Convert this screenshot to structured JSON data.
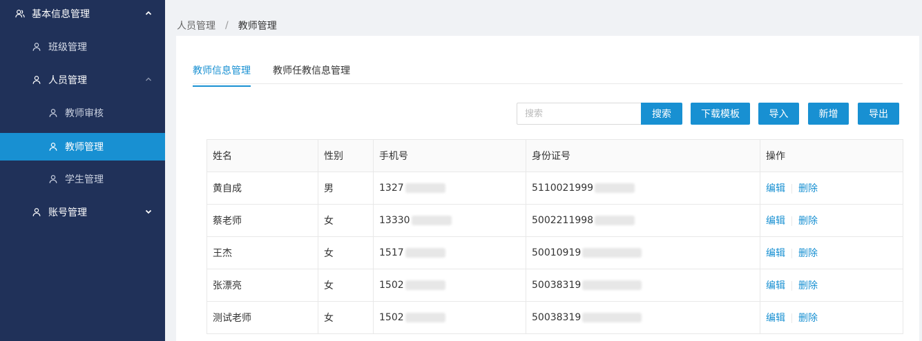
{
  "sidebar": {
    "items": [
      {
        "label": "基本信息管理",
        "icon": "user-group-icon",
        "expanded": true
      },
      {
        "label": "班级管理",
        "icon": "user-icon"
      },
      {
        "label": "人员管理",
        "icon": "user-icon",
        "expanded": true
      },
      {
        "label": "教师审核",
        "icon": "user-icon"
      },
      {
        "label": "教师管理",
        "icon": "user-icon",
        "active": true
      },
      {
        "label": "学生管理",
        "icon": "user-icon"
      },
      {
        "label": "账号管理",
        "icon": "user-icon",
        "expanded": false
      }
    ]
  },
  "breadcrumb": {
    "parent": "人员管理",
    "separator": "/",
    "current": "教师管理"
  },
  "tabs": [
    {
      "label": "教师信息管理",
      "active": true
    },
    {
      "label": "教师任教信息管理"
    }
  ],
  "toolbar": {
    "search_placeholder": "搜索",
    "search_label": "搜索",
    "download_template_label": "下载模板",
    "import_label": "导入",
    "add_label": "新增",
    "export_label": "导出"
  },
  "table": {
    "columns": [
      "姓名",
      "性别",
      "手机号",
      "身份证号",
      "操作"
    ],
    "rows": [
      {
        "name": "黄自成",
        "gender": "男",
        "phone": "1327",
        "id_card": "5110021999"
      },
      {
        "name": "蔡老师",
        "gender": "女",
        "phone": "13330",
        "id_card": "5002211998"
      },
      {
        "name": "王杰",
        "gender": "女",
        "phone": "1517",
        "id_card": "50010919"
      },
      {
        "name": "张漂亮",
        "gender": "女",
        "phone": "1502",
        "id_card": "50038319"
      },
      {
        "name": "测试老师",
        "gender": "女",
        "phone": "1502",
        "id_card": "50038319"
      }
    ],
    "actions": {
      "edit": "编辑",
      "delete": "删除"
    }
  },
  "colors": {
    "sidebar_bg": "#203159",
    "accent": "#1890d2"
  }
}
